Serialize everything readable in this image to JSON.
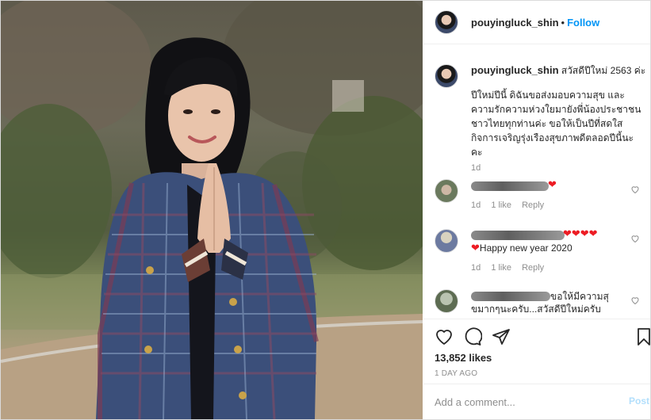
{
  "post": {
    "username": "pouyingluck_shin",
    "follow_label": "Follow",
    "caption_title": "สวัสดีปีใหม่ 2563 ค่ะ",
    "caption_lines": [
      "ปีใหม่ปีนี้ ดิฉันขอส่งมอบความสุข และ",
      "ความรักความห่วงใยมายังพี่น้องประชาชน",
      "ชาวไทยทุกท่านค่ะ ขอให้เป็นปีที่สดใส",
      "กิจการเจริญรุ่งเรืองสุขภาพดีตลอดปีนี้นะ",
      "คะ"
    ],
    "caption_time": "1d",
    "likes": "13,852 likes",
    "posted_ago": "1 DAY AGO"
  },
  "comments": [
    {
      "text": "",
      "hearts": "❤",
      "time": "1d",
      "likes": "1 like",
      "reply": "Reply"
    },
    {
      "text": "Happy new year 2020",
      "hearts": "❤❤❤❤",
      "lead_heart": "❤",
      "time": "1d",
      "likes": "1 like",
      "reply": "Reply"
    },
    {
      "line1": "ขอให้มีความสุ",
      "line2": "ขมากๆนะครับ...สวัสดีปีใหม่ครับ"
    }
  ],
  "comment_box": {
    "placeholder": "Add a comment...",
    "post_label": "Post"
  },
  "icons": [
    "heart-icon",
    "comment-icon",
    "share-icon",
    "bookmark-icon",
    "like-comment-icon"
  ],
  "colors": {
    "follow": "#0095f6",
    "heart": "#ed1c24",
    "muted": "#8e8e8e"
  }
}
